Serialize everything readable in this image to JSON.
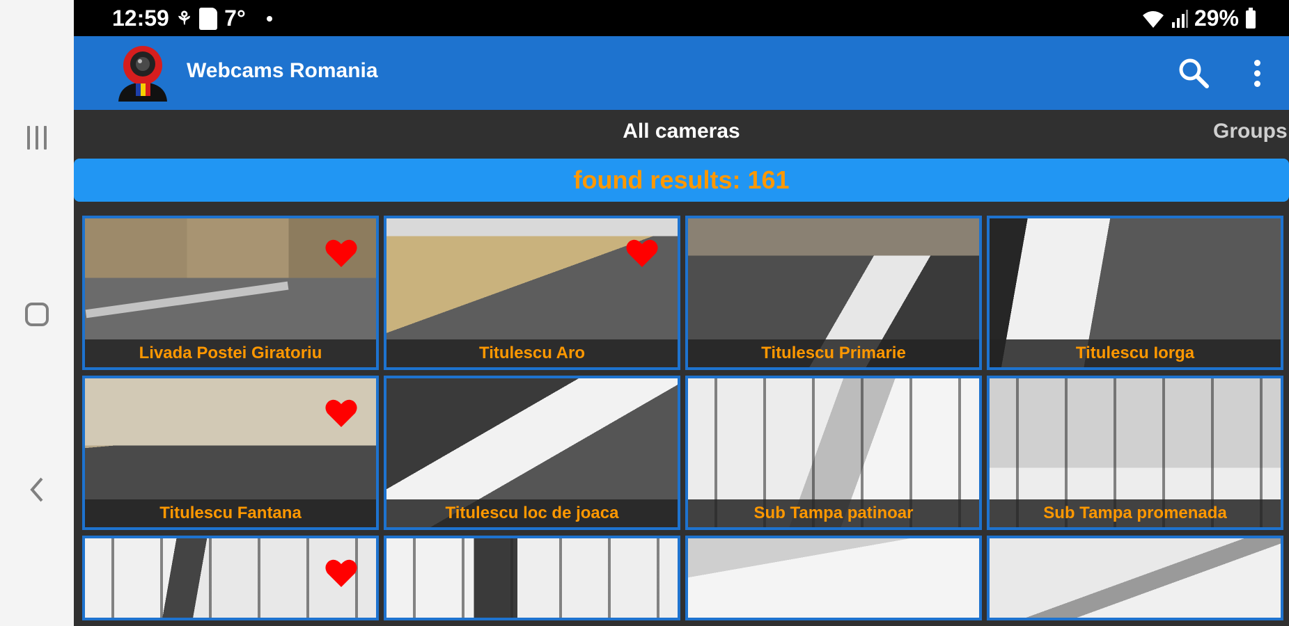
{
  "system_nav": {
    "recents": "recents-icon",
    "home": "home-icon",
    "back": "back-icon"
  },
  "status_bar": {
    "time": "12:59",
    "temp": "7°",
    "battery": "29%"
  },
  "app_bar": {
    "title": "Webcams Romania",
    "search_icon": "search-icon",
    "more_icon": "more-vert-icon"
  },
  "tabs": [
    {
      "label": "All cameras",
      "selected": true
    },
    {
      "label": "Groups",
      "selected": false
    }
  ],
  "results": {
    "text": "found results: 161"
  },
  "colors": {
    "app_bar": "#1e73cf",
    "banner": "#2196f3",
    "caption_text": "#ff9800",
    "favorite": "#ff0000"
  },
  "cameras": [
    {
      "name": "Livada Postei Giratoriu",
      "favorite": true
    },
    {
      "name": "Titulescu Aro",
      "favorite": true
    },
    {
      "name": "Titulescu Primarie",
      "favorite": false
    },
    {
      "name": "Titulescu Iorga",
      "favorite": false
    },
    {
      "name": "Titulescu Fantana",
      "favorite": true
    },
    {
      "name": "Titulescu loc de joaca",
      "favorite": false
    },
    {
      "name": "Sub Tampa patinoar",
      "favorite": false
    },
    {
      "name": "Sub Tampa promenada",
      "favorite": false
    },
    {
      "name": "",
      "favorite": true
    },
    {
      "name": "",
      "favorite": false
    },
    {
      "name": "",
      "favorite": false
    },
    {
      "name": "",
      "favorite": false
    }
  ]
}
